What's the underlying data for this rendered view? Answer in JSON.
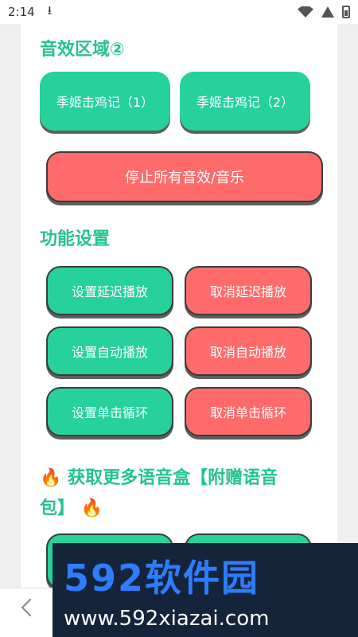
{
  "status": {
    "time": "2:14",
    "download_icon": "download-icon",
    "icons": [
      "signal-icon",
      "wifi-icon",
      "battery-icon"
    ]
  },
  "sections": {
    "sound_area": {
      "title": "音效区域②",
      "buttons": [
        "季姬击鸡记（1）",
        "季姬击鸡记（2）"
      ],
      "stop_button": "停止所有音效/音乐"
    },
    "settings": {
      "title": "功能设置",
      "buttons_left": [
        "设置延迟播放",
        "设置自动播放",
        "设置单击循环"
      ],
      "buttons_right": [
        "取消延迟播放",
        "取消自动播放",
        "取消单击循环"
      ]
    },
    "more": {
      "title_line1": "获取更多语音盒【附赠语音",
      "title_line2": "包】",
      "fire_icon": "🔥"
    }
  },
  "watermark": {
    "title": "592软件园",
    "url": "www.592xiazai.com"
  },
  "colors": {
    "accent": "#24c38e",
    "green_button": "#27d19b",
    "red_button": "#ff6b6b"
  }
}
